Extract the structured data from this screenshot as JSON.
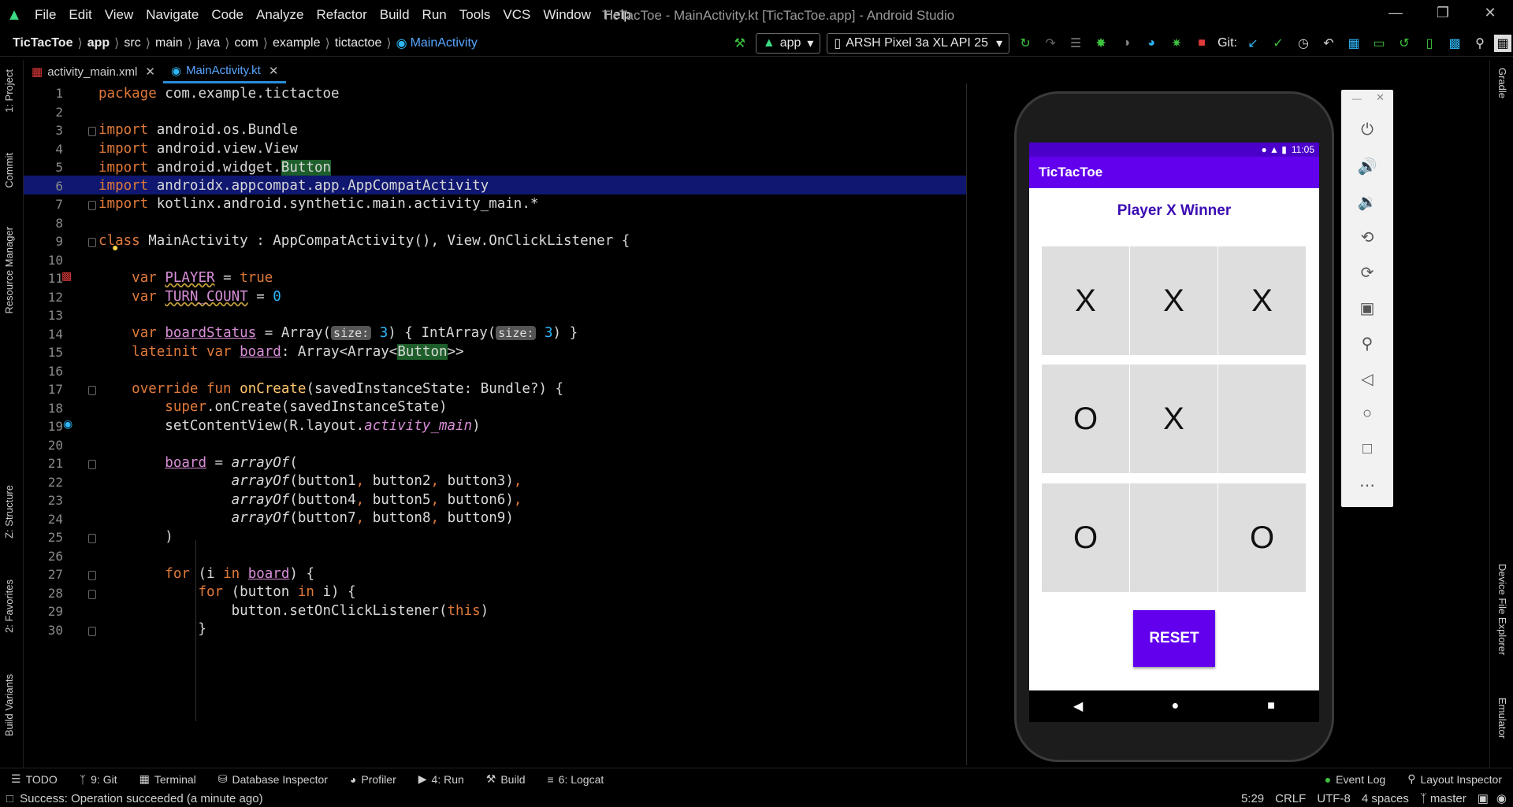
{
  "menu": {
    "items": [
      "File",
      "Edit",
      "View",
      "Navigate",
      "Code",
      "Analyze",
      "Refactor",
      "Build",
      "Run",
      "Tools",
      "VCS",
      "Window",
      "Help"
    ],
    "window_title": "TicTacToe - MainActivity.kt [TicTacToe.app] - Android Studio"
  },
  "breadcrumb": [
    "TicTacToe",
    "app",
    "src",
    "main",
    "java",
    "com",
    "example",
    "tictactoe",
    "MainActivity"
  ],
  "toolbar": {
    "config": "app",
    "device": "ARSH Pixel 3a XL API 25",
    "git_label": "Git:"
  },
  "tabs": [
    {
      "label": "activity_main.xml"
    },
    {
      "label": "MainActivity.kt"
    }
  ],
  "sidebar_left": [
    "1: Project",
    "Commit",
    "Resource Manager",
    "Z: Structure",
    "2: Favorites",
    "Build Variants"
  ],
  "sidebar_right": [
    "Gradle",
    "Device File Explorer",
    "Emulator"
  ],
  "editor": {
    "line_numbers": [
      "1",
      "2",
      "3",
      "4",
      "5",
      "6",
      "7",
      "8",
      "9",
      "10",
      "11",
      "12",
      "13",
      "14",
      "15",
      "16",
      "17",
      "18",
      "19",
      "20",
      "21",
      "22",
      "23",
      "24",
      "25",
      "26",
      "27",
      "28",
      "29",
      "30"
    ]
  },
  "emulator": {
    "time": "11:05",
    "app_title": "TicTacToe",
    "status_text": "Player X Winner",
    "board": [
      "X",
      "X",
      "X",
      "O",
      "X",
      "",
      "O",
      "",
      "O"
    ],
    "reset_label": "RESET"
  },
  "bottom_tools": [
    "TODO",
    "9: Git",
    "Terminal",
    "Database Inspector",
    "Profiler",
    "4: Run",
    "Build",
    "6: Logcat",
    "Event Log",
    "Layout Inspector"
  ],
  "statusline": {
    "message": "Success: Operation succeeded (a minute ago)",
    "position": "5:29",
    "line_sep": "CRLF",
    "encoding": "UTF-8",
    "indent": "4 spaces",
    "branch": "master"
  }
}
